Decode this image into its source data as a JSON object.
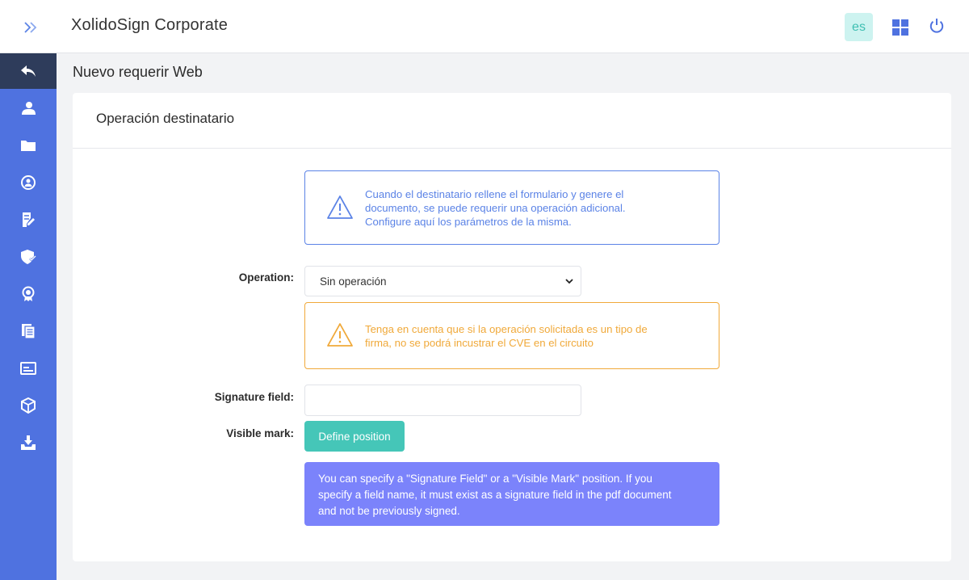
{
  "app": {
    "title": "XolidoSign Corporate"
  },
  "header": {
    "language": "es"
  },
  "sidebar": {
    "items": [
      {
        "icon": "back-arrow-icon"
      },
      {
        "icon": "user-icon"
      },
      {
        "icon": "folder-icon"
      },
      {
        "icon": "circle-user-icon"
      },
      {
        "icon": "document-edit-icon"
      },
      {
        "icon": "shield-check-icon"
      },
      {
        "icon": "certificate-icon"
      },
      {
        "icon": "documents-icon"
      },
      {
        "icon": "card-window-icon"
      },
      {
        "icon": "box-icon"
      },
      {
        "icon": "download-tray-icon"
      }
    ]
  },
  "page": {
    "title": "Nuevo requerir Web"
  },
  "card": {
    "title": "Operación destinatario",
    "info_alert": {
      "line1": "Cuando el destinatario rellene el formulario y genere el",
      "line2": "documento, se puede requerir una operación adicional.",
      "line3": "Configure aquí los parámetros de la misma."
    },
    "operation": {
      "label": "Operation:",
      "value": "Sin operación"
    },
    "warning_alert": {
      "line1": "Tenga en cuenta que si la operación solicitada es un tipo de",
      "line2": "firma, no se podrá incustrar el CVE en el circuito"
    },
    "signature_field": {
      "label": "Signature field:",
      "value": ""
    },
    "visible_mark": {
      "label": "Visible mark:",
      "button": "Define position"
    },
    "note": {
      "line1": "You can specify a \"Signature Field\" or a \"Visible Mark\" position. If you",
      "line2": "specify a field name, it must exist as a signature field in the pdf document",
      "line3": "and not be previously signed."
    }
  },
  "colors": {
    "sidebar": "#4f72e0",
    "sidebar_active": "#2e3c5b",
    "info": "#5b83e6",
    "warning": "#f0a93a",
    "teal": "#45c6b8",
    "note": "#7b83fb"
  }
}
